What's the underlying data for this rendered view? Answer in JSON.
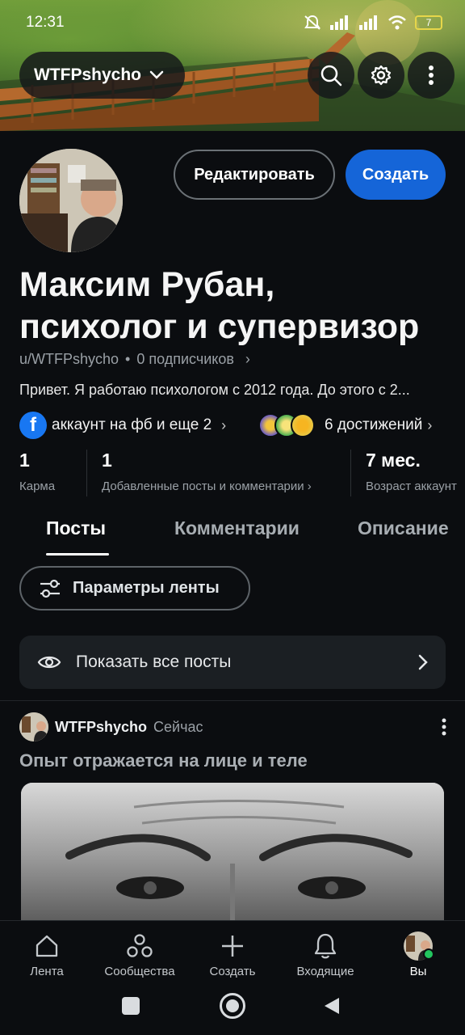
{
  "status_bar": {
    "time": "12:31",
    "battery": "7"
  },
  "header": {
    "username": "WTFPshycho"
  },
  "profile": {
    "edit_button": "Редактировать",
    "create_button": "Создать",
    "display_name_line1": "Максим Рубан,",
    "display_name_line2": "психолог и супервизор",
    "handle": "u/WTFPshycho",
    "separator": "•",
    "followers": "0 подписчиков",
    "bio": "Привет. Я работаю психологом с 2012 года. До этого с 2...",
    "social_links": "аккаунт на фб и еще 2",
    "achievements": "6 достижений"
  },
  "stats": [
    {
      "value": "1",
      "label": "Карма"
    },
    {
      "value": "1",
      "label": "Добавленные посты и комментарии"
    },
    {
      "value": "7 мес.",
      "label": "Возраст аккаунт"
    }
  ],
  "tabs": [
    {
      "label": "Посты",
      "active": true
    },
    {
      "label": "Комментарии",
      "active": false
    },
    {
      "label": "Описание",
      "active": false
    }
  ],
  "feed_options_button": "Параметры ленты",
  "show_all_posts": "Показать все посты",
  "post": {
    "author": "WTFPshycho",
    "time": "Сейчас",
    "title": "Опыт отражается на лице и теле"
  },
  "bottom_nav": [
    {
      "label": "Лента",
      "icon": "home-icon"
    },
    {
      "label": "Сообщества",
      "icon": "communities-icon"
    },
    {
      "label": "Создать",
      "icon": "plus-icon"
    },
    {
      "label": "Входящие",
      "icon": "bell-icon"
    },
    {
      "label": "Вы",
      "icon": "avatar"
    }
  ],
  "colors": {
    "accent": "#1565d8",
    "background": "#0b0d10",
    "card": "#1b1f23",
    "online": "#22c55e"
  }
}
